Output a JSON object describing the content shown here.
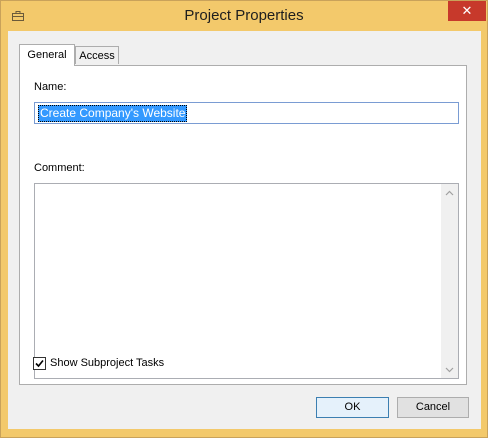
{
  "window": {
    "title": "Project Properties",
    "close_label": "✕"
  },
  "tabs": [
    {
      "label": "General",
      "active": true
    },
    {
      "label": "Access",
      "active": false
    }
  ],
  "general": {
    "name_label": "Name:",
    "name_value": "Create Company's Website",
    "comment_label": "Comment:",
    "comment_value": "",
    "show_subproject_tasks_label": "Show Subproject Tasks",
    "show_subproject_tasks_checked": true
  },
  "buttons": {
    "ok_label": "OK",
    "cancel_label": "Cancel"
  },
  "colors": {
    "frame": "#f3c96b",
    "close": "#c7392b",
    "selection": "#3399ff"
  }
}
